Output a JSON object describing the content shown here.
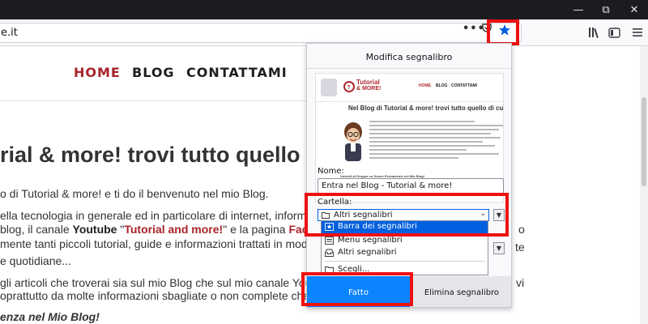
{
  "browser": {
    "url": "e.it",
    "page_actions": "•••",
    "icons": [
      "minimize-icon",
      "maximize-icon",
      "close-icon",
      "pocket-icon",
      "bookmark-star-icon",
      "library-icon",
      "sidebar-icon",
      "hamburger-menu-icon"
    ]
  },
  "site": {
    "nav": [
      "HOME",
      "BLOG",
      "CONTATTAMI"
    ],
    "headline": "rial & more! trovi tutto quello",
    "para1": "o di Tutorial & more! e ti do il benvenuto nel mio Blog.",
    "para2a": "ella tecnologia in generale ed in particolare di internet, informatica, sm",
    "para2b_prefix": "blog, il canale ",
    "para2b_youtube": "Youtube",
    "para2b_quote": " \"",
    "para2b_name": "Tutorial and more!",
    "para2b_mid": "\" e la pagina ",
    "para2b_fb": "Facebook",
    "para2b_after": " i",
    "para2c": "mente tanti piccoli tutorial, guide e informazioni trattati in modo semplice",
    "para2d": "e quotidiane...",
    "para3a": "gli articoli che troverai sia sul mio Blog che sul mio canale Youtube, s",
    "para3b": "oprattutto da molte informazioni sbagliate o non complete che ho trova",
    "para4": "enza nel Mio Blog!",
    "right_fragments": {
      "r1": "o",
      "r2": "te",
      "r3": "vi"
    }
  },
  "panel": {
    "title": "Modifica segnalibro",
    "preview": {
      "logo_line1": "Tutorial",
      "logo_line2": "& MORE!",
      "nav": [
        "HOME",
        "BLOG",
        "CONTATTAMI"
      ],
      "headline": "Nel Blog di Tutorial & more! trovi tutto quello di cui h",
      "bold_line": "Unisciti al Gruppo su Donne Permanente nel Mio Blog!"
    },
    "name_label": "Nome:",
    "name_value": "Entra nel Blog - Tutorial & more!",
    "folder_label": "Cartella:",
    "folder_selected": "Altri segnalibri",
    "folder_options": [
      "Barra dei segnalibri",
      "Menu segnalibri",
      "Altri segnalibri",
      "Scegli..."
    ],
    "done_label": "Fatto",
    "remove_label": "Elimina segnalibro"
  },
  "colors": {
    "accent_blue": "#0a84ff",
    "highlight_red": "#ee1111",
    "site_red": "#a8232a"
  }
}
